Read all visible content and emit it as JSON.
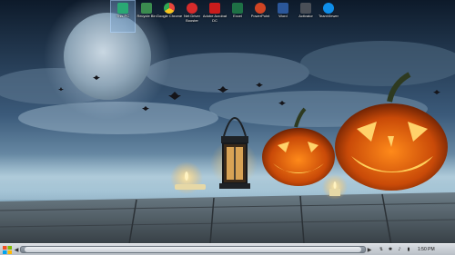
{
  "desktop": {
    "icons": [
      {
        "label": "This PC",
        "name": "this-pc-icon",
        "color": "#2aa874",
        "selected": true
      },
      {
        "label": "Recycle Bin",
        "name": "recycle-bin-icon",
        "color": "#3b8c4f"
      },
      {
        "label": "Google Chrome",
        "name": "chrome-icon",
        "color": "#e8453c"
      },
      {
        "label": "Net Driver Booster",
        "name": "driver-booster-icon",
        "color": "#d62b2b"
      },
      {
        "label": "Adobe Acrobat DC",
        "name": "acrobat-icon",
        "color": "#c91c1c"
      },
      {
        "label": "Excel",
        "name": "excel-icon",
        "color": "#1e7145"
      },
      {
        "label": "PowerPoint",
        "name": "powerpoint-icon",
        "color": "#d04423"
      },
      {
        "label": "Word",
        "name": "word-icon",
        "color": "#2b579a"
      },
      {
        "label": "Activator",
        "name": "activator-icon",
        "color": "#4a4f57"
      },
      {
        "label": "TeamViewer",
        "name": "teamviewer-icon",
        "color": "#0e8ee9"
      }
    ]
  },
  "taskbar": {
    "start_icon": "windows-logo-icon",
    "scroll_left": "◀",
    "scroll_right": "▶",
    "tray_icons": [
      {
        "name": "network-icon",
        "glyph": "⇅"
      },
      {
        "name": "bluetooth-icon",
        "glyph": "✱"
      },
      {
        "name": "volume-icon",
        "glyph": "♪"
      },
      {
        "name": "battery-icon",
        "glyph": "▮"
      }
    ],
    "clock": "1:50 PM"
  }
}
